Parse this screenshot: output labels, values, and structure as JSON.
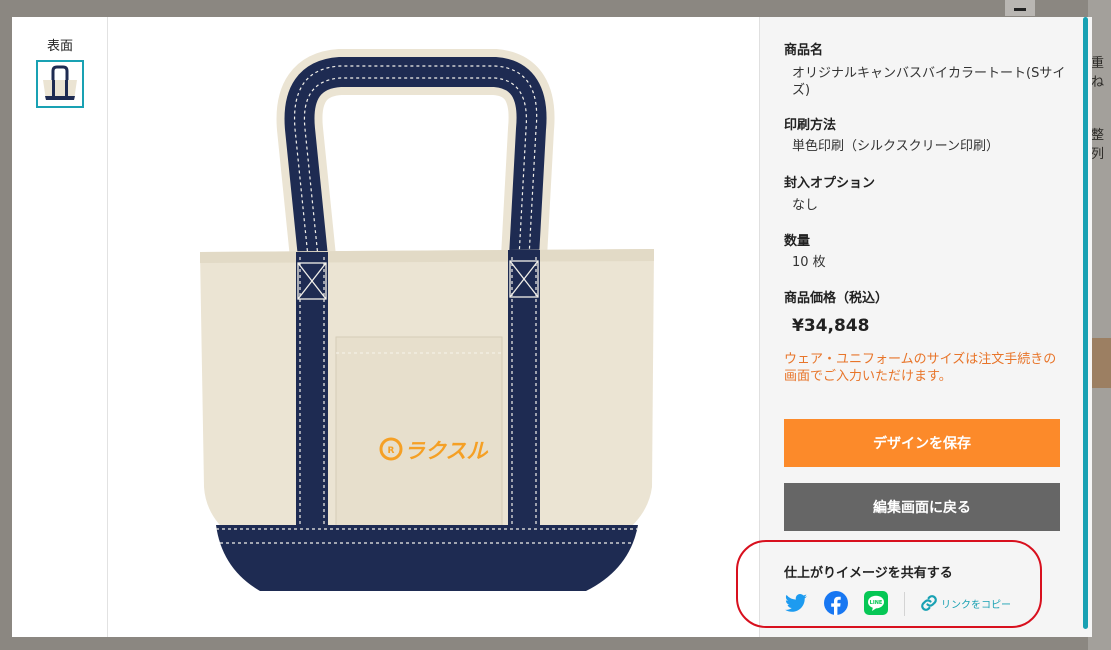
{
  "thumbnails": {
    "front_label": "表面"
  },
  "product": {
    "name_label": "商品名",
    "name_value": "オリジナルキャンバスバイカラートート(Sサイズ)",
    "print_label": "印刷方法",
    "print_value": "単色印刷（シルクスクリーン印刷）",
    "insert_label": "封入オプション",
    "insert_value": "なし",
    "qty_label": "数量",
    "qty_value": "10 枚",
    "price_label": "商品価格（税込）",
    "price_value": "¥34,848",
    "note": "ウェア・ユニフォームのサイズは注文手続きの画面でご入力いただけます。"
  },
  "buttons": {
    "save": "デザインを保存",
    "back": "編集画面に戻る"
  },
  "share": {
    "title": "仕上がりイメージを共有する",
    "copy_link": "リンクをコピー",
    "icons": [
      "twitter-icon",
      "facebook-icon",
      "line-icon",
      "link-icon"
    ]
  },
  "design": {
    "logo_text": "ラクスル"
  },
  "background": {
    "frag1": "重ね",
    "frag2": "整列"
  },
  "colors": {
    "accent_orange": "#fc8a2a",
    "accent_teal": "#19a1b3",
    "note_orange": "#e8752a",
    "back_gray": "#666666",
    "highlight_red": "#d8101e",
    "bag_navy": "#1e2b52",
    "bag_canvas": "#ebe4d3"
  }
}
